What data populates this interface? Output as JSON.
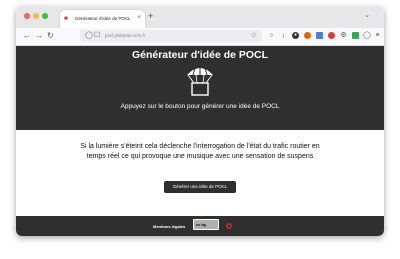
{
  "browser": {
    "tab": {
      "title": "Générateur d'idée de POCL"
    },
    "address_bar": {
      "url": "pocl.philotrain.info.fr"
    }
  },
  "header": {
    "title": "Générateur d'idée de POCL",
    "tagline": "Appuyez sur le bouton pour générer une idée de POCL"
  },
  "main": {
    "idea_text": "Si la lumière s'éteint cela déclenche l'interrogation de l'état du trafic routier en temps réel ce qui provoque une musique avec une sensation de suspens",
    "generate_button": "Générer une idée de POCL"
  },
  "footer": {
    "legal_link": "Mentions légales",
    "license_badge": "cc by"
  },
  "colors": {
    "header_bg": "#2f2f2f",
    "button_bg": "#2f2f2f",
    "page_bg": "#ffffff"
  }
}
